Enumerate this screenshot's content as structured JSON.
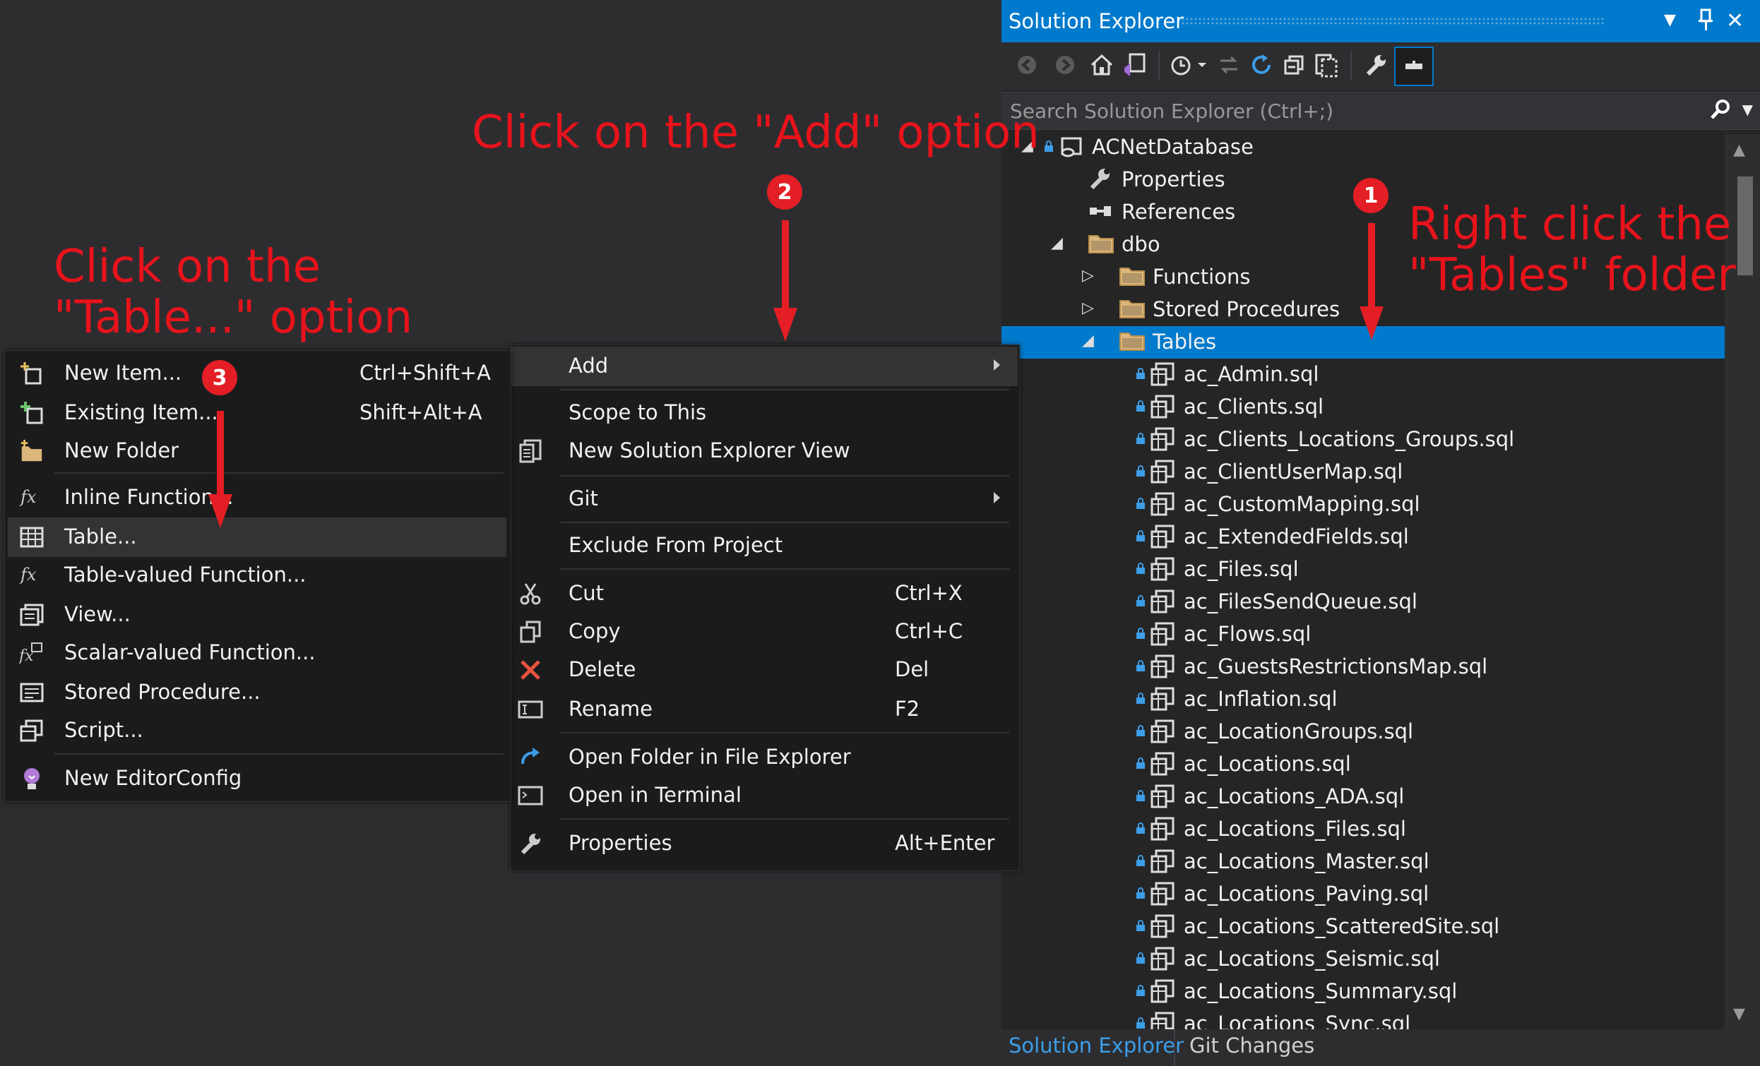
{
  "solution_explorer": {
    "title": "Solution Explorer",
    "search_placeholder": "Search Solution Explorer (Ctrl+;)",
    "tree": [
      {
        "label": "ACNetDatabase",
        "icon": "project-icon",
        "expander": "expanded"
      },
      {
        "label": "Properties",
        "icon": "wrench-icon"
      },
      {
        "label": "References",
        "icon": "references-icon"
      },
      {
        "label": "dbo",
        "icon": "folder-icon",
        "expander": "expanded"
      },
      {
        "label": "Functions",
        "icon": "folder-icon",
        "expander": "collapsed"
      },
      {
        "label": "Stored Procedures",
        "icon": "folder-icon",
        "expander": "collapsed"
      },
      {
        "label": "Tables",
        "icon": "folder-icon",
        "expander": "expanded",
        "selected": true
      },
      {
        "label": "ac_Admin.sql",
        "icon": "sql-table-icon"
      },
      {
        "label": "ac_Clients.sql",
        "icon": "sql-table-icon"
      },
      {
        "label": "ac_Clients_Locations_Groups.sql",
        "icon": "sql-table-icon"
      },
      {
        "label": "ac_ClientUserMap.sql",
        "icon": "sql-table-icon"
      },
      {
        "label": "ac_CustomMapping.sql",
        "icon": "sql-table-icon"
      },
      {
        "label": "ac_ExtendedFields.sql",
        "icon": "sql-table-icon"
      },
      {
        "label": "ac_Files.sql",
        "icon": "sql-table-icon"
      },
      {
        "label": "ac_FilesSendQueue.sql",
        "icon": "sql-table-icon"
      },
      {
        "label": "ac_Flows.sql",
        "icon": "sql-table-icon"
      },
      {
        "label": "ac_GuestsRestrictionsMap.sql",
        "icon": "sql-table-icon"
      },
      {
        "label": "ac_Inflation.sql",
        "icon": "sql-table-icon"
      },
      {
        "label": "ac_LocationGroups.sql",
        "icon": "sql-table-icon"
      },
      {
        "label": "ac_Locations.sql",
        "icon": "sql-table-icon"
      },
      {
        "label": "ac_Locations_ADA.sql",
        "icon": "sql-table-icon"
      },
      {
        "label": "ac_Locations_Files.sql",
        "icon": "sql-table-icon"
      },
      {
        "label": "ac_Locations_Master.sql",
        "icon": "sql-table-icon"
      },
      {
        "label": "ac_Locations_Paving.sql",
        "icon": "sql-table-icon"
      },
      {
        "label": "ac_Locations_ScatteredSite.sql",
        "icon": "sql-table-icon"
      },
      {
        "label": "ac_Locations_Seismic.sql",
        "icon": "sql-table-icon"
      },
      {
        "label": "ac_Locations_Summary.sql",
        "icon": "sql-table-icon"
      },
      {
        "label": "ac_Locations_Sync.sql",
        "icon": "sql-table-icon"
      }
    ],
    "bottom_tabs": [
      {
        "label": "Solution Explorer",
        "active": true
      },
      {
        "label": "Git Changes",
        "active": false
      }
    ]
  },
  "context_menu": {
    "items": [
      {
        "label": "Add",
        "submenu": true,
        "highlighted": true,
        "icon": ""
      },
      {
        "label": "Scope to This",
        "icon": ""
      },
      {
        "label": "New Solution Explorer View",
        "icon": "new-view-icon"
      },
      {
        "label": "Git",
        "submenu": true,
        "icon": ""
      },
      {
        "label": "Exclude From Project",
        "icon": ""
      },
      {
        "label": "Cut",
        "shortcut": "Ctrl+X",
        "icon": "scissors-icon"
      },
      {
        "label": "Copy",
        "shortcut": "Ctrl+C",
        "icon": "copy-icon"
      },
      {
        "label": "Delete",
        "shortcut": "Del",
        "icon": "delete-icon"
      },
      {
        "label": "Rename",
        "shortcut": "F2",
        "icon": "rename-icon"
      },
      {
        "label": "Open Folder in File Explorer",
        "icon": "open-folder-icon"
      },
      {
        "label": "Open in Terminal",
        "icon": "terminal-icon"
      },
      {
        "label": "Properties",
        "shortcut": "Alt+Enter",
        "icon": "wrench-icon"
      }
    ]
  },
  "add_submenu": {
    "items": [
      {
        "label": "New Item...",
        "shortcut": "Ctrl+Shift+A",
        "icon": "new-item-icon"
      },
      {
        "label": "Existing Item...",
        "shortcut": "Shift+Alt+A",
        "icon": "existing-item-icon"
      },
      {
        "label": "New Folder",
        "icon": "new-folder-icon"
      },
      {
        "label": "Inline Function...",
        "icon": "fx-icon"
      },
      {
        "label": "Table...",
        "icon": "table-icon",
        "highlighted": true
      },
      {
        "label": "Table-valued Function...",
        "icon": "fx-icon"
      },
      {
        "label": "View...",
        "icon": "view-icon"
      },
      {
        "label": "Scalar-valued Function...",
        "icon": "scalar-fx-icon"
      },
      {
        "label": "Stored Procedure...",
        "icon": "stored-procedure-icon"
      },
      {
        "label": "Script...",
        "icon": "script-icon"
      },
      {
        "label": "New EditorConfig",
        "icon": "lightbulb-icon"
      }
    ]
  },
  "annotations": {
    "step1_text_line1": "Right click the",
    "step1_text_line2": "\"Tables\" folder",
    "step2_text": "Click on the \"Add\" option",
    "step3_text_line1": "Click on the",
    "step3_text_line2": "\"Table...\" option",
    "badge1": "1",
    "badge2": "2",
    "badge3": "3"
  },
  "colors": {
    "accent": "#007acc",
    "annotation_red": "#e8131b",
    "background": "#2d2d30",
    "menu_bg": "#1b1b1c"
  }
}
